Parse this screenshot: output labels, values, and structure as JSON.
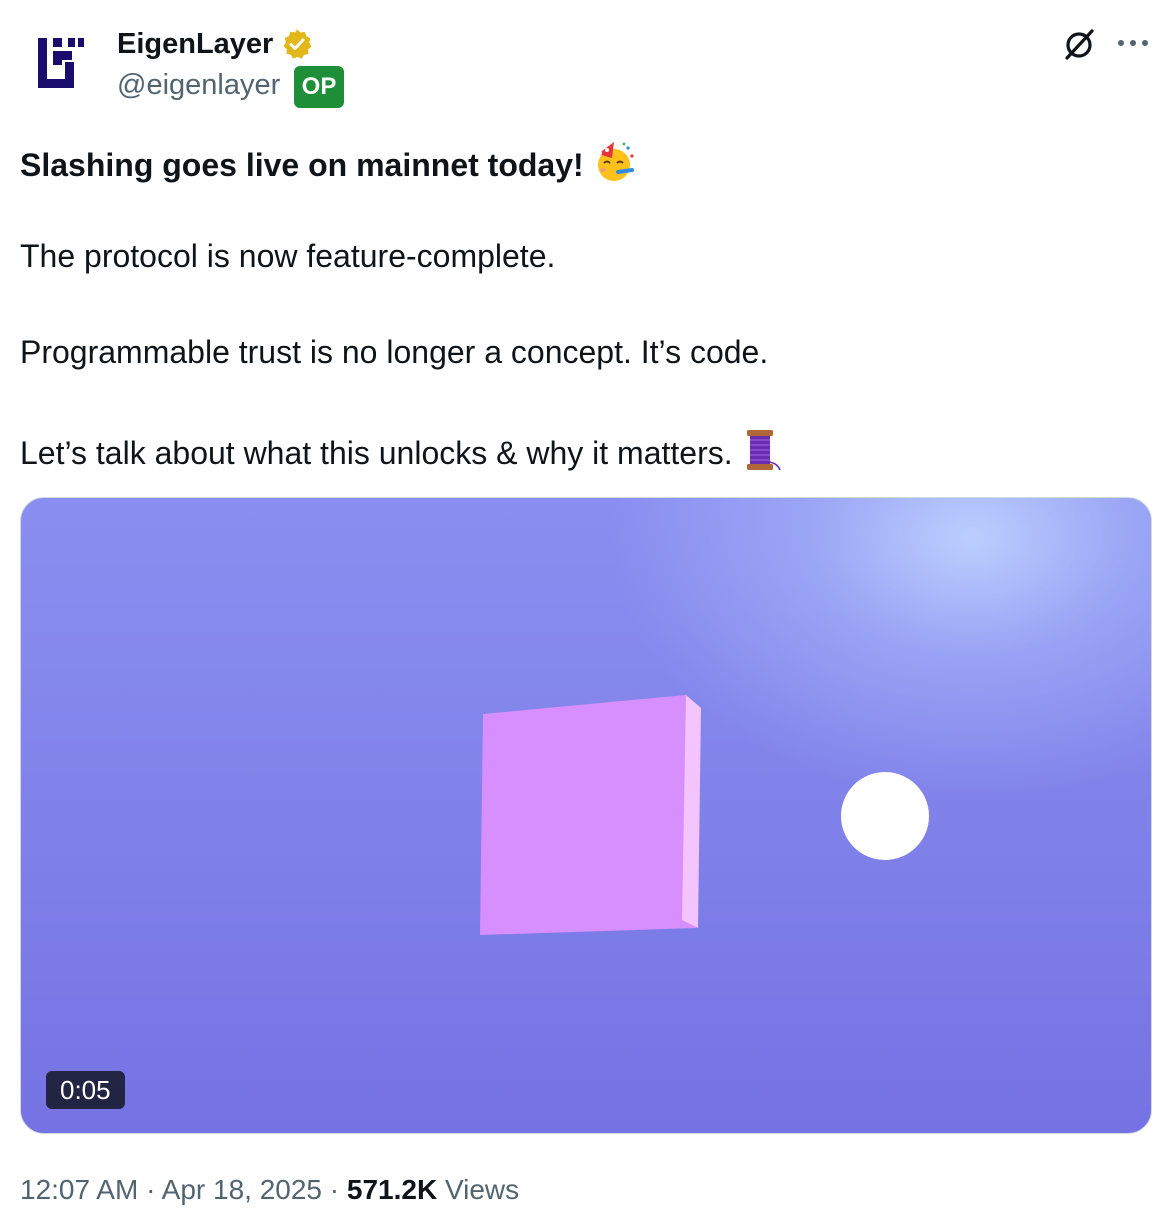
{
  "author": {
    "name": "EigenLayer",
    "handle": "@eigenlayer",
    "badge": "OP",
    "verified_color": "#e2b719",
    "op_badge_color": "#1e8f38",
    "avatar_icon": "eigenlayer-logo-icon"
  },
  "header_actions": {
    "grok_icon": "grok-icon",
    "more_icon": "more-icon"
  },
  "tweet": {
    "line_1": "Slashing goes live on mainnet today!",
    "line_1_emoji": "partying-face-emoji",
    "line_2": "The protocol is now feature-complete.",
    "line_3": "Programmable trust is no longer a concept. It’s code.",
    "line_4": "Let’s talk about what this unlocks & why it matters.",
    "line_4_emoji": "thread-spool-emoji"
  },
  "media": {
    "type": "video",
    "duration": "0:05",
    "background_color": "#8183ea",
    "square_color": "#d38ffd",
    "circle_color": "#ffffff"
  },
  "meta": {
    "time": "12:07 AM",
    "separator": "·",
    "date": "Apr 18, 2025",
    "views_count": "571.2K",
    "views_label": "Views"
  }
}
